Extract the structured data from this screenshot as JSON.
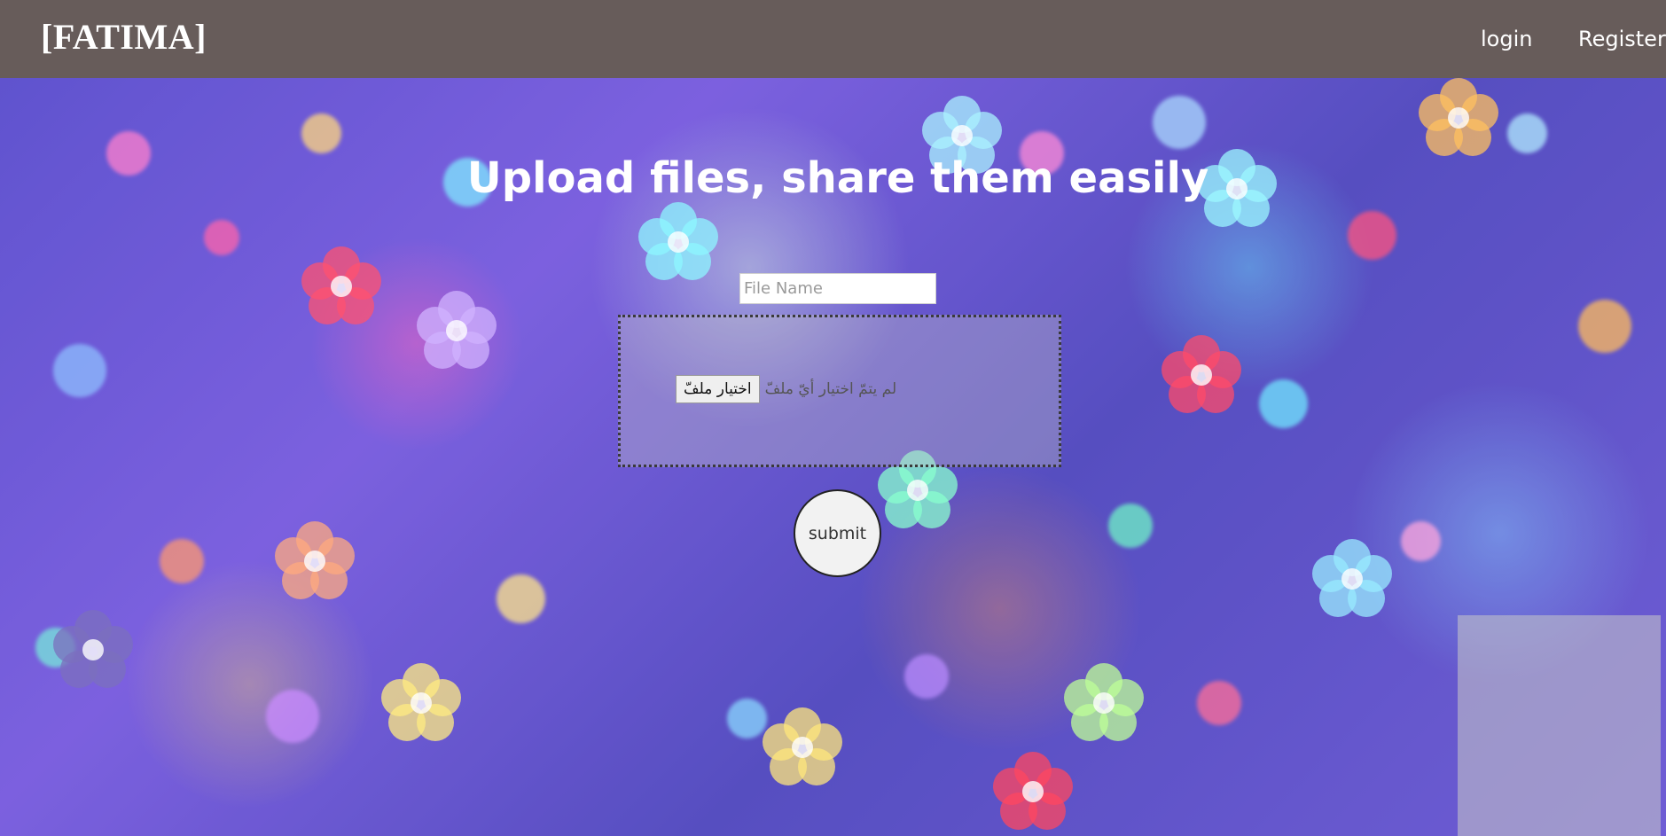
{
  "navbar": {
    "brand": "[FATIMA]",
    "links": [
      {
        "label": "login"
      },
      {
        "label": "Register"
      }
    ],
    "background_color": "#675c5a"
  },
  "main": {
    "headline": "Upload files, share them easily",
    "file_name_input": {
      "placeholder": "File Name",
      "value": ""
    },
    "file_picker": {
      "button_label": "اختيار ملفّ",
      "status_text": "لم يتمّ اختيار أيّ ملفّ"
    },
    "submit_label": "submit"
  },
  "background": {
    "description_colors": [
      "#4a3cc8",
      "#6a4bdb",
      "#ff50b4",
      "#5adcff",
      "#ffd25a"
    ]
  }
}
